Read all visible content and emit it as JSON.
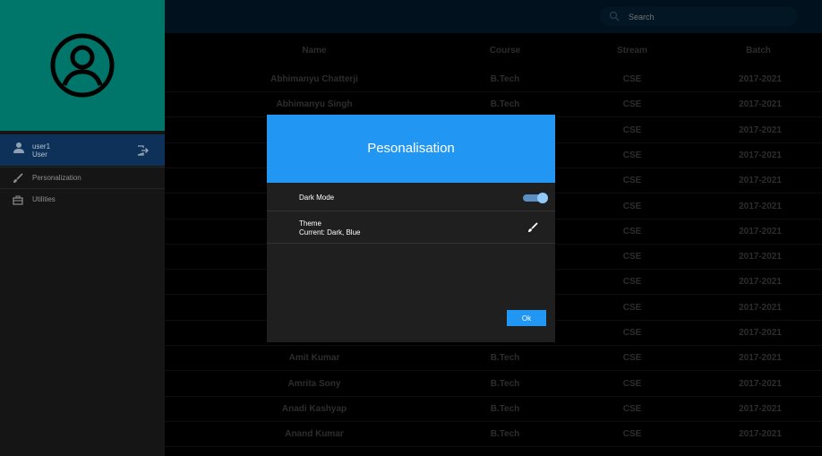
{
  "sidebar": {
    "user": {
      "name": "user1",
      "role": "User"
    },
    "items": [
      {
        "label": "Personalization",
        "icon": "brush-icon"
      },
      {
        "label": "Utilities",
        "icon": "toolbox-icon"
      }
    ]
  },
  "topbar": {
    "search_placeholder": "Search"
  },
  "table": {
    "headers": [
      "Name",
      "Course",
      "Stream",
      "Batch"
    ],
    "rows": [
      [
        "Abhimanyu Chatterji",
        "B.Tech",
        "CSE",
        "2017-2021"
      ],
      [
        "Abhimanyu Singh",
        "B.Tech",
        "CSE",
        "2017-2021"
      ],
      [
        "",
        "",
        "CSE",
        "2017-2021"
      ],
      [
        "",
        "",
        "CSE",
        "2017-2021"
      ],
      [
        "",
        "",
        "CSE",
        "2017-2021"
      ],
      [
        "",
        "",
        "CSE",
        "2017-2021"
      ],
      [
        "",
        "",
        "CSE",
        "2017-2021"
      ],
      [
        "",
        "",
        "CSE",
        "2017-2021"
      ],
      [
        "",
        "",
        "CSE",
        "2017-2021"
      ],
      [
        "",
        "",
        "CSE",
        "2017-2021"
      ],
      [
        "",
        "",
        "CSE",
        "2017-2021"
      ],
      [
        "Amit Kumar",
        "B.Tech",
        "CSE",
        "2017-2021"
      ],
      [
        "Amrita Sony",
        "B.Tech",
        "CSE",
        "2017-2021"
      ],
      [
        "Anadi Kashyap",
        "B.Tech",
        "CSE",
        "2017-2021"
      ],
      [
        "Anand Kumar",
        "B.Tech",
        "CSE",
        "2017-2021"
      ]
    ]
  },
  "dialog": {
    "title": "Pesonalisation",
    "dark_mode_label": "Dark Mode",
    "dark_mode_on": true,
    "theme_label": "Theme",
    "theme_current": "Current: Dark, Blue",
    "ok_label": "Ok"
  },
  "colors": {
    "accent": "#2196f3",
    "profile_bg": "#007569",
    "sidebar_bg": "#151515",
    "dialog_bg": "#1f1f1f"
  }
}
